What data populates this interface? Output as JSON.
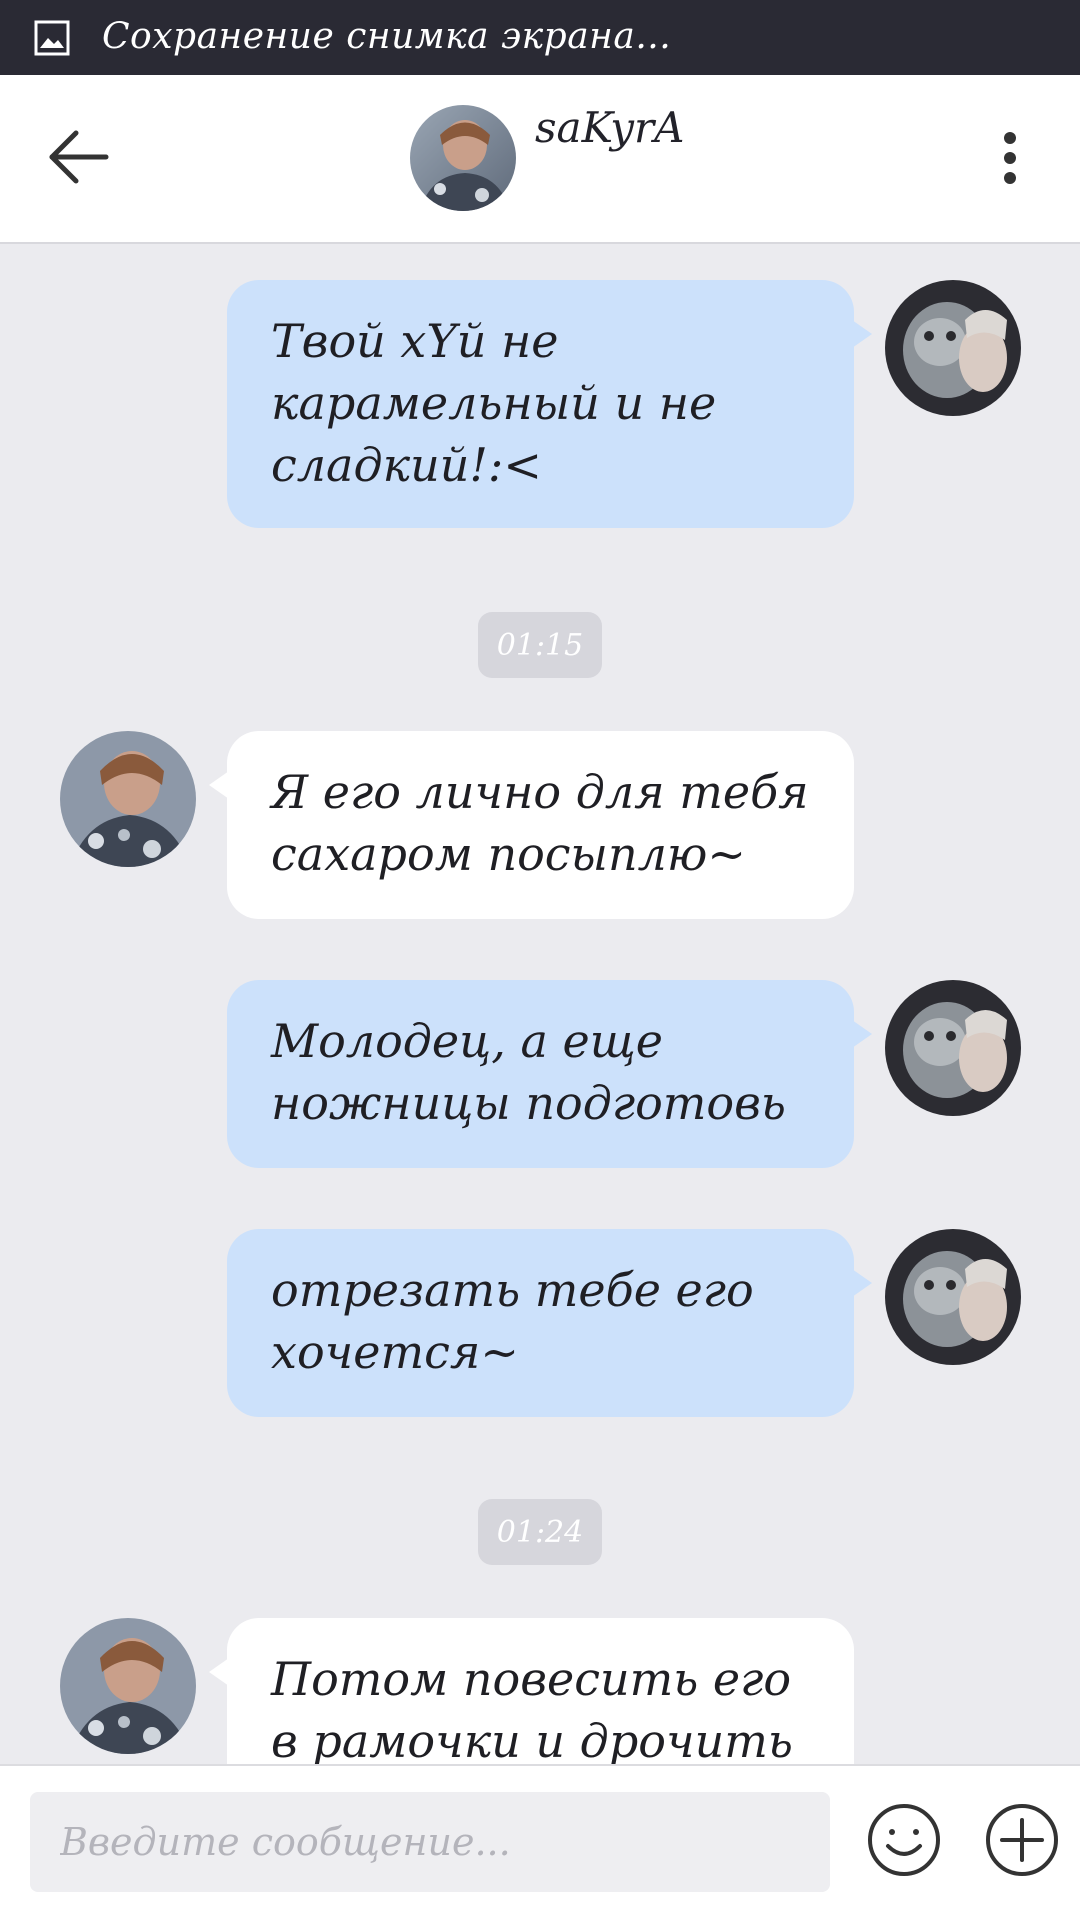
{
  "status_bar": {
    "text": "Сохранение снимка экрана...",
    "icon": "screenshot-icon"
  },
  "header": {
    "title": "saKyrA",
    "back_icon": "arrow-left-icon",
    "more_icon": "more-vertical-icon"
  },
  "messages": [
    {
      "direction": "out",
      "text": "Твой хYй не карамельный и не сладкий!:<"
    },
    {
      "type": "time",
      "text": "01:15"
    },
    {
      "direction": "in",
      "text": "Я его лично для тебя сахаром посыплю~"
    },
    {
      "direction": "out",
      "text": "Молодец, а еще ножницы подготовь"
    },
    {
      "direction": "out",
      "text": "отрезать тебе его хочется~"
    },
    {
      "type": "time",
      "text": "01:24"
    },
    {
      "direction": "in",
      "text": "Потом повесить его в рамочки и дрочить"
    }
  ],
  "input": {
    "placeholder": "Введите сообщение...",
    "emoji_icon": "smiley-icon",
    "plus_icon": "plus-circle-icon"
  },
  "colors": {
    "status_bar": "#2a2a34",
    "chat_background": "#ebebef",
    "outgoing_bubble": "#cce1fb",
    "incoming_bubble": "#ffffff",
    "time_pill": "#d6d6dc"
  }
}
